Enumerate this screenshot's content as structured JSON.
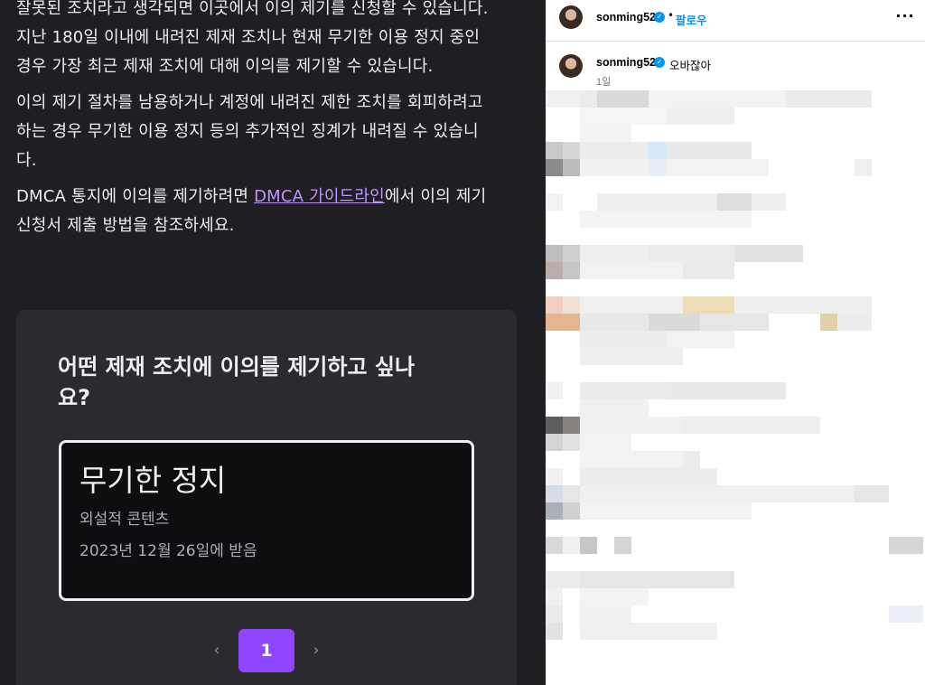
{
  "left": {
    "paragraph1": [
      "잘못된 조치라고 생각되면 이곳에서 이의 제기를 신청할 수 있습니다.",
      "지난 180일 이내에 내려진 제재 조치나 현재 무기한 이용 정지 중인",
      "경우 가장 최근 제재 조치에 대해 이의를 제기할 수 있습니다."
    ],
    "paragraph2": [
      "이의 제기 절차를 남용하거나 계정에 내려진 제한 조치를 회피하려고",
      "하는 경우 무기한 이용 정지 등의 추가적인 징계가 내려질 수 있습니",
      "다."
    ],
    "paragraph3": {
      "before_link": "DMCA 통지에 이의를 제기하려면 ",
      "link": "DMCA 가이드라인",
      "after_link": "에서 이의 제기",
      "line2": "신청서 제출 방법을 참조하세요."
    },
    "card": {
      "question_line1": "어떤 제재 조치에 이의를 제기하고 싶나",
      "question_line2": "요?",
      "option": {
        "title": "무기한 정지",
        "reason": "외설적 콘텐츠",
        "date": "2023년 12월 26일에 받음"
      },
      "pagination": {
        "prev": "‹",
        "current": "1",
        "next": "›"
      }
    },
    "colors": {
      "background": "#1f1f23",
      "card": "#2b2a30",
      "accent": "#9147ff",
      "link": "#bf94ff"
    }
  },
  "right": {
    "header": {
      "username": "sonming52",
      "verified_icon": "verified-badge-icon",
      "separator": "•",
      "follow_label": "팔로우",
      "more_icon": "more-options-icon",
      "more_label": "···"
    },
    "comment": {
      "username": "sonming52",
      "text": "오바잖아",
      "time": "1일"
    },
    "colors": {
      "follow": "#0095f6",
      "verified": "#0095f6"
    }
  }
}
